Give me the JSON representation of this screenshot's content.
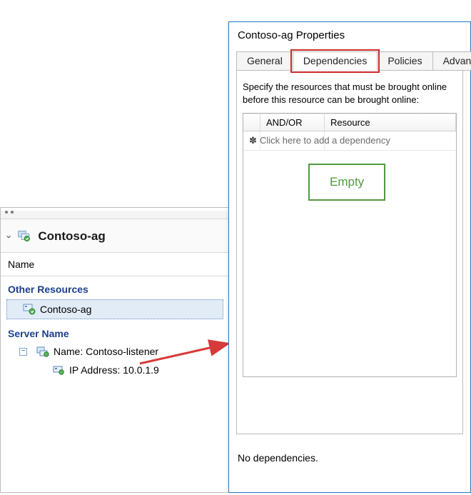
{
  "left": {
    "header_title": "Contoso-ag",
    "column_name": "Name",
    "sections": {
      "other_resources": "Other Resources",
      "server_name": "Server Name"
    },
    "items": {
      "contoso_ag": "Contoso-ag",
      "listener_label": "Name: Contoso-listener",
      "ip_label": "IP Address: 10.0.1.9"
    }
  },
  "dialog": {
    "title": "Contoso-ag Properties",
    "tabs": {
      "general": "General",
      "dependencies": "Dependencies",
      "policies": "Policies",
      "advanced": "Advanc"
    },
    "instruction": "Specify the resources that must be brought online before this resource can be brought online:",
    "grid": {
      "col_andor": "AND/OR",
      "col_resource": "Resource",
      "placeholder": "Click here to add a dependency"
    },
    "empty_badge": "Empty",
    "status": "No dependencies."
  }
}
